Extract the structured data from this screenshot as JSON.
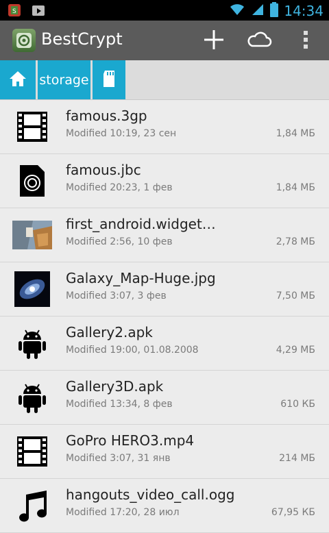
{
  "status_bar": {
    "time": "14:34"
  },
  "app_bar": {
    "title": "BestCrypt"
  },
  "breadcrumbs": {
    "storage": "storage"
  },
  "files": [
    {
      "name": "famous.3gp",
      "modified": "Modified 10:19, 23 сен",
      "size": "1,84 МБ",
      "icon": "film-icon"
    },
    {
      "name": "famous.jbc",
      "modified": "Modified 20:23, 1 фев",
      "size": "1,84 МБ",
      "icon": "encrypted-file-icon"
    },
    {
      "name": "first_android.widget…",
      "modified": "Modified 2:56, 10 фев",
      "size": "2,78 МБ",
      "icon": "image-thumbnail"
    },
    {
      "name": "Galaxy_Map-Huge.jpg",
      "modified": "Modified 3:07, 3 фев",
      "size": "7,50 МБ",
      "icon": "galaxy-thumbnail"
    },
    {
      "name": "Gallery2.apk",
      "modified": "Modified 19:00, 01.08.2008",
      "size": "4,29 МБ",
      "icon": "android-icon"
    },
    {
      "name": "Gallery3D.apk",
      "modified": "Modified 13:34, 8 фев",
      "size": "610 КБ",
      "icon": "android-icon"
    },
    {
      "name": "GoPro HERO3.mp4",
      "modified": "Modified 3:07, 31 янв",
      "size": "214 МБ",
      "icon": "film-icon"
    },
    {
      "name": "hangouts_video_call.ogg",
      "modified": "Modified 17:20, 28 июл",
      "size": "67,95 КБ",
      "icon": "music-note-icon"
    }
  ]
}
